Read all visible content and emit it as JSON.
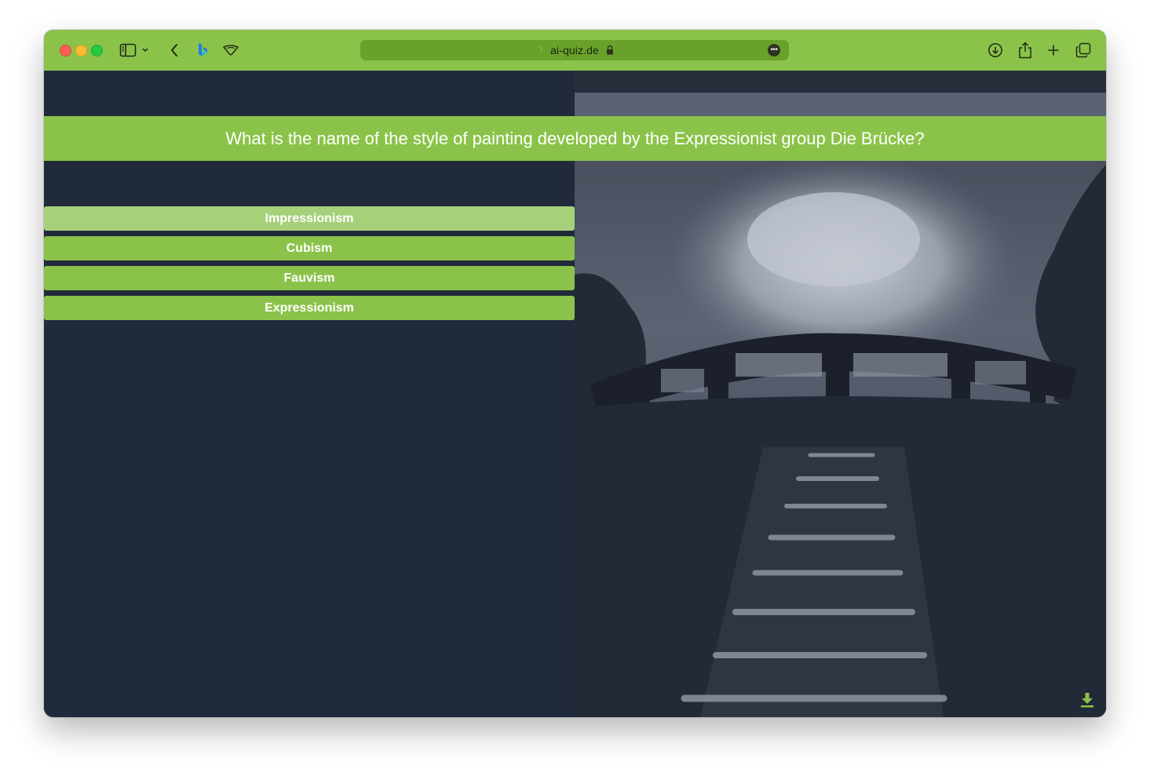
{
  "browser": {
    "address": "ai-quiz.de",
    "help_glyph": "?",
    "more_glyph": "•••"
  },
  "quiz": {
    "question": "What is the name of the style of painting developed by the Expressionist group Die Brücke?",
    "answers": [
      {
        "label": "Impressionism",
        "state": "hover"
      },
      {
        "label": "Cubism",
        "state": "default"
      },
      {
        "label": "Fauvism",
        "state": "default"
      },
      {
        "label": "Expressionism",
        "state": "default"
      }
    ]
  },
  "colors": {
    "accent": "#8bc34a",
    "accent_hover": "#a7d07a",
    "background": "#212a3a",
    "url_bar": "#6aa12a"
  },
  "icons": [
    "sidebar-icon",
    "chevron-down-icon",
    "back-icon",
    "bing-icon",
    "privacy-shield-icon",
    "lock-icon",
    "more-icon",
    "download-icon",
    "share-icon",
    "new-tab-icon",
    "tabs-overview-icon",
    "image-download-icon"
  ]
}
